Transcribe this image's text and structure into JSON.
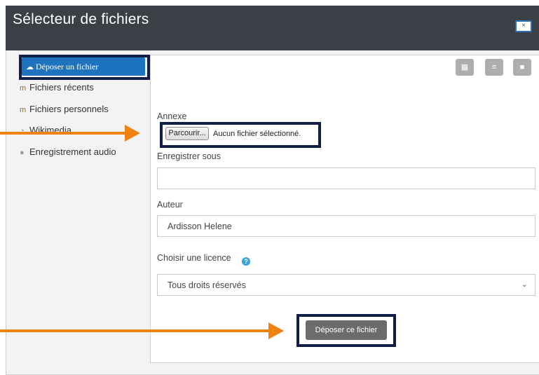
{
  "dialog": {
    "title": "Sélecteur de fichiers",
    "close_label": "×"
  },
  "sidebar": {
    "items": [
      {
        "label": "Déposer un fichier",
        "icon": "cloud-upload-icon",
        "active": true
      },
      {
        "label": "Fichiers récents",
        "icon": "moodle-hat-icon"
      },
      {
        "label": "Fichiers personnels",
        "icon": "moodle-hat-icon"
      },
      {
        "label": "Wikimedia",
        "icon": "wikimedia-icon"
      },
      {
        "label": "Enregistrement audio",
        "icon": "microphone-icon"
      }
    ]
  },
  "view_buttons": [
    {
      "name": "grid-view",
      "icon": "grid-icon",
      "glyph": "▦"
    },
    {
      "name": "list-view",
      "icon": "list-icon",
      "glyph": "≡"
    },
    {
      "name": "folder-view",
      "icon": "folder-icon",
      "glyph": "■"
    }
  ],
  "form": {
    "attachment_label": "Annexe",
    "browse_label": "Parcourir...",
    "no_file_text": "Aucun fichier sélectionné.",
    "save_as_label": "Enregistrer sous",
    "save_as_value": "",
    "author_label": "Auteur",
    "author_value": "Ardisson Helene",
    "license_label": "Choisir une licence",
    "license_value": "Tous droits réservés",
    "help_glyph": "?",
    "submit_label": "Déposer ce fichier"
  },
  "colors": {
    "header": "#3a4046",
    "active": "#1e73be",
    "highlight": "#0f1f45",
    "arrow": "#f0820f",
    "button": "#6c6c6c"
  }
}
